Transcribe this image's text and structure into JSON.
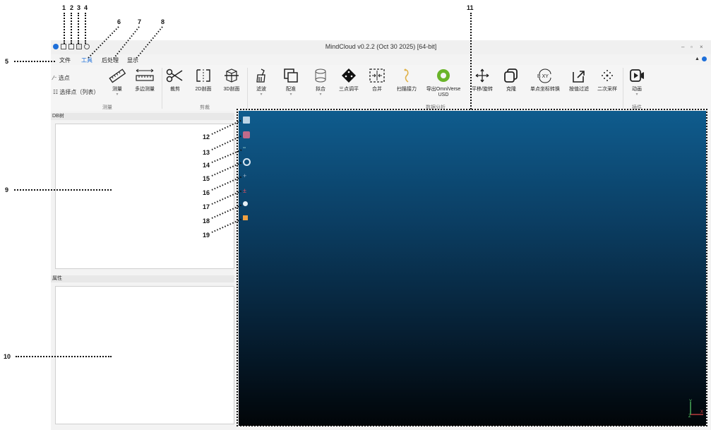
{
  "window": {
    "title": "MindCloud v0.2.2 (Oct 30 2025) [64-bit]",
    "controls": [
      "–",
      "▫",
      "×"
    ]
  },
  "menubar": {
    "items": [
      {
        "label": "文件",
        "active": false
      },
      {
        "label": "工具",
        "active": true
      },
      {
        "label": "后处理",
        "active": false
      },
      {
        "label": "显示",
        "active": false
      }
    ]
  },
  "ribbon": {
    "select_point": "选点",
    "select_point_list": "选择点（列表）",
    "tools": [
      {
        "label": "测量",
        "icon": "ruler-icon"
      },
      {
        "label": "多边测量",
        "icon": "multi-measure-icon"
      },
      {
        "label": "裁剪",
        "icon": "scissors-icon"
      },
      {
        "label": "2D剖面",
        "icon": "section-2d-icon"
      },
      {
        "label": "3D剖面",
        "icon": "section-3d-icon"
      },
      {
        "label": "滤波",
        "icon": "filter-brush-icon"
      },
      {
        "label": "配准",
        "icon": "register-icon"
      },
      {
        "label": "拟合",
        "icon": "fit-cylinder-icon"
      },
      {
        "label": "三点调平",
        "icon": "level-diamond-icon"
      },
      {
        "label": "合并",
        "icon": "merge-icon"
      },
      {
        "label": "扫描接力",
        "icon": "scan-relay-icon"
      },
      {
        "label": "导出OmniVerse",
        "label2": "USD",
        "icon": "omniverse-icon"
      },
      {
        "label": "平移/旋转",
        "icon": "move-rotate-icon"
      },
      {
        "label": "克隆",
        "icon": "clone-icon"
      },
      {
        "label": "单点坐标转换",
        "icon": "coord-transform-icon"
      },
      {
        "label": "按值过滤",
        "icon": "value-filter-icon"
      },
      {
        "label": "二次采样",
        "icon": "subsample-icon"
      },
      {
        "label": "动画",
        "icon": "animation-icon"
      }
    ],
    "groups": [
      {
        "label": "测量"
      },
      {
        "label": "剪裁"
      },
      {
        "label": "数据分析"
      },
      {
        "label": "插件"
      }
    ],
    "icon_glyph_coord": "B  XY"
  },
  "panels": {
    "db_tree_title": "DB树",
    "properties_title": "属性"
  },
  "viewport": {
    "axis_y": "Y",
    "axis_z": "Z",
    "axis_x": "X"
  },
  "callouts": [
    "1",
    "2",
    "3",
    "4",
    "5",
    "6",
    "7",
    "8",
    "9",
    "10",
    "11",
    "12",
    "13",
    "14",
    "15",
    "16",
    "17",
    "18",
    "19"
  ],
  "colors": {
    "accent": "#1e6fd9",
    "viewport_top": "#0f5c8e",
    "viewport_bottom": "#010508"
  }
}
